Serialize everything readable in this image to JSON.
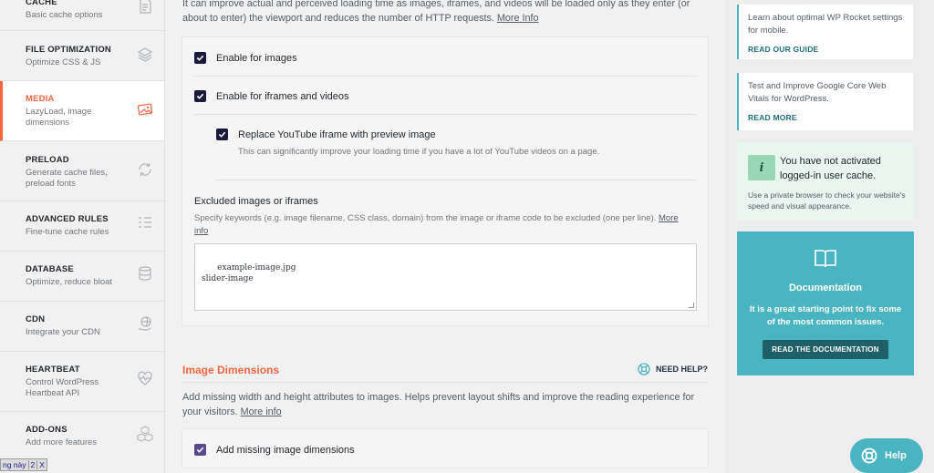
{
  "sidebar": {
    "items": [
      {
        "title": "CACHE",
        "sub": "Basic cache options",
        "active": false
      },
      {
        "title": "FILE OPTIMIZATION",
        "sub": "Optimize CSS & JS",
        "active": false
      },
      {
        "title": "MEDIA",
        "sub": "LazyLoad, image dimensions",
        "active": true
      },
      {
        "title": "PRELOAD",
        "sub": "Generate cache files, preload fonts",
        "active": false
      },
      {
        "title": "ADVANCED RULES",
        "sub": "Fine-tune cache rules",
        "active": false
      },
      {
        "title": "DATABASE",
        "sub": "Optimize, reduce bloat",
        "active": false
      },
      {
        "title": "CDN",
        "sub": "Integrate your CDN",
        "active": false
      },
      {
        "title": "HEARTBEAT",
        "sub": "Control WordPress Heartbeat API",
        "active": false
      },
      {
        "title": "ADD-ONS",
        "sub": "Add more features",
        "active": false
      }
    ]
  },
  "main": {
    "intro": "It can improve actual and perceived loading time as images, iframes, and videos will be loaded only as they enter (or about to enter) the viewport and reduces the number of HTTP requests.",
    "intro_link": "More Info",
    "options": {
      "images": "Enable for images",
      "iframes": "Enable for iframes and videos",
      "youtube": "Replace YouTube iframe with preview image",
      "youtube_desc": "This can significantly improve your loading time if you have a lot of YouTube videos on a page."
    },
    "excluded": {
      "title": "Excluded images or iframes",
      "desc": "Specify keywords (e.g. image filename, CSS class, domain) from the image or iframe code to be excluded (one per line).",
      "link": "More info",
      "value": "example-image.jpg\nslider-image"
    },
    "dimensions": {
      "title": "Image Dimensions",
      "need_help": "NEED HELP?",
      "desc": "Add missing width and height attributes to images. Helps prevent layout shifts and improve the reading experience for your visitors.",
      "link": "More info",
      "option": "Add missing image dimensions"
    }
  },
  "right": {
    "tip1": {
      "text": "Learn about optimal WP Rocket settings for mobile.",
      "link": "READ OUR GUIDE"
    },
    "tip2": {
      "text": "Test and Improve Google Core Web Vitals for WordPress.",
      "link": "READ MORE"
    },
    "notice": {
      "icon": "i",
      "title": "You have not activated logged-in user cache.",
      "desc": "Use a private browser to check your website's speed and visual appearance."
    },
    "doc": {
      "title": "Documentation",
      "desc": "It is a great starting point to fix some of the most common issues.",
      "button": "READ THE DOCUMENTATION"
    }
  },
  "help": {
    "label": "Help"
  },
  "ime": {
    "text": "ng này",
    "num": "2",
    "close": "X"
  },
  "colors": {
    "accent": "#f56640",
    "teal": "#4ab5c0",
    "checkbox": "#1a1a3a"
  }
}
